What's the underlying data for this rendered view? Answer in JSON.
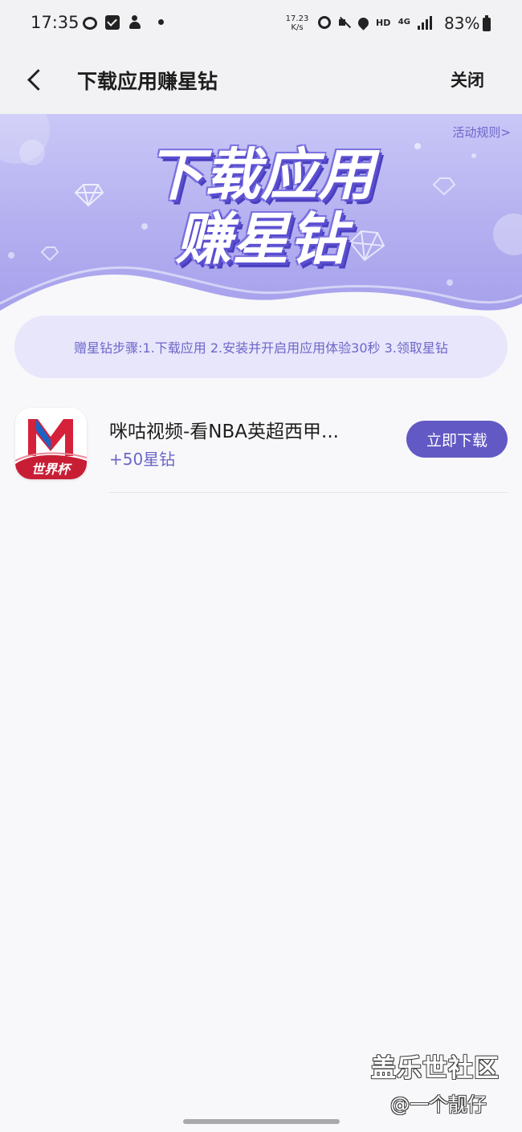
{
  "status_bar": {
    "time": "17:35",
    "net_speed_value": "17.23",
    "net_speed_unit": "K/s",
    "hd_label": "HD",
    "network_type": "4G",
    "battery_percent": "83%",
    "battery_level": 0.83
  },
  "header": {
    "title": "下载应用赚星钻",
    "close_label": "关闭"
  },
  "banner": {
    "rules_link": "活动规则>",
    "heading_line1": "下载应用",
    "heading_line2": "赚星钻"
  },
  "steps": {
    "text": "赠星钻步骤:1.下载应用 2.安装并开启用应用体验30秒 3.领取星钻"
  },
  "apps": [
    {
      "name": "咪咕视频-看NBA英超西甲...",
      "reward": "+50星钻",
      "icon_badge": "世界杯",
      "action_label": "立即下载"
    }
  ],
  "watermark": {
    "main": "盖乐世社区",
    "sub": "@一个靓仔"
  },
  "colors": {
    "accent": "#6259c4",
    "accent_text": "#6d66c9",
    "banner_light": "#c9c7f7",
    "banner_dark": "#a6a0ec",
    "pill_bg": "#e7e6fb",
    "app_icon_red": "#d6213a"
  }
}
